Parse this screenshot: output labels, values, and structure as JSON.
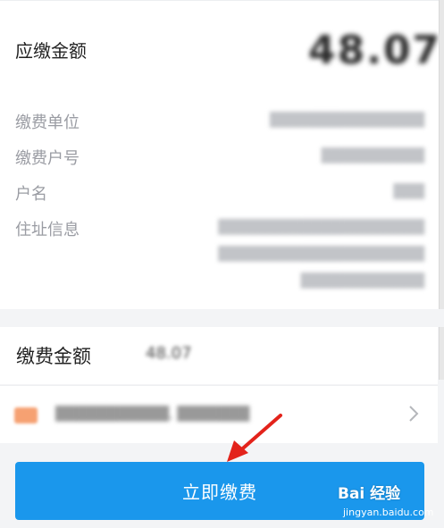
{
  "summary": {
    "amount_due_label": "应缴金额",
    "amount_due_value": "48.07"
  },
  "info": {
    "unit_label": "缴费单位",
    "unit_value": "███████████████",
    "account_label": "缴费户号",
    "account_value": "██████████",
    "name_label": "户名",
    "name_value": "███",
    "address_label": "住址信息",
    "address_lines": [
      "████████████████████",
      "████████████████████",
      "████████████"
    ]
  },
  "payment": {
    "amount_label": "缴费金额",
    "amount_value": "48.07",
    "method_text": "███████████, ███████"
  },
  "action": {
    "pay_button_label": "立即缴费"
  },
  "watermark": {
    "logo_text": "Bai   经验",
    "url": "jingyan.baidu.com"
  },
  "colors": {
    "button": "#1a97ec",
    "arrow": "#e3231b",
    "card": "#ffffff",
    "background": "#f3f4f6"
  }
}
